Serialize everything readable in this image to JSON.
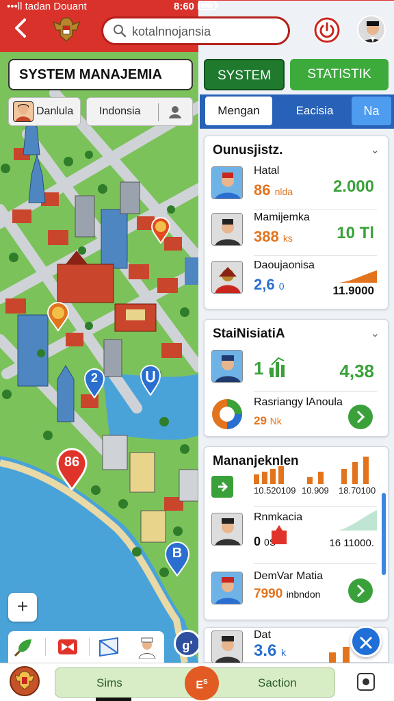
{
  "status": {
    "carrier": "•••ll tadan Douant",
    "time": "8:60 PM",
    "battery": "▮▮"
  },
  "header": {
    "search_text": "kotalnnojansia"
  },
  "map": {
    "title": "SYSTEM MANAJEMIA",
    "chip_user": "Danlula",
    "chip_location": "Indonsia",
    "markers": [
      "2",
      "86",
      "B"
    ],
    "zoom_label": "+",
    "fab_label": "g'"
  },
  "tabs": {
    "system": "SYSTEM",
    "statistik": "STATISTIK"
  },
  "segments": {
    "s1": "Mengan",
    "s2": "Eacisia",
    "s3": "Na"
  },
  "cards": [
    {
      "title": "Ounusjistz.",
      "rows": [
        {
          "name": "Hatal",
          "value": "86",
          "unit": "nlda",
          "big": "2.000",
          "value_color": "#e2741e"
        },
        {
          "name": "Mamijemka",
          "value": "388",
          "unit": "ks",
          "big": "10 Tl",
          "value_color": "#e2741e"
        },
        {
          "name": "Daoujaonisa",
          "value": "2,6",
          "unit": "0",
          "big": "11.9000",
          "value_color": "#2a6fd0"
        }
      ]
    },
    {
      "title": "StaiNisiatiA",
      "rows": [
        {
          "name": "",
          "value": "1",
          "unit": "k",
          "big": "4,38",
          "value_color": "#3aa13a"
        },
        {
          "name": "Rasriangy lAnoula",
          "value": "29",
          "unit": "Nk",
          "big": "",
          "value_color": "#e2741e"
        }
      ]
    },
    {
      "title": "Mananjeknlen",
      "bar_labels": [
        "10.520109",
        "10.909",
        "18.70100"
      ],
      "rows": [
        {
          "name": "Rnmkacia",
          "value": "0",
          "unit": "0S",
          "big": "16 11000.",
          "value_color": "#111"
        },
        {
          "name": "DemVar Matia",
          "value": "7990",
          "unit": "inbndon",
          "big": "",
          "value_color": "#e2741e"
        }
      ]
    },
    {
      "title": "Dat",
      "rows": [
        {
          "name": "",
          "value": "3.6",
          "unit": "k",
          "big": "",
          "value_color": "#2a6fd0"
        }
      ]
    }
  ],
  "bottom": {
    "left_label": "Sims",
    "right_label": "Saction",
    "mid_label": "E",
    "mid_sup": "S"
  },
  "colors": {
    "header": "#d9322b",
    "green": "#3aa13a",
    "blue": "#2761b8",
    "orange": "#e2741e"
  }
}
